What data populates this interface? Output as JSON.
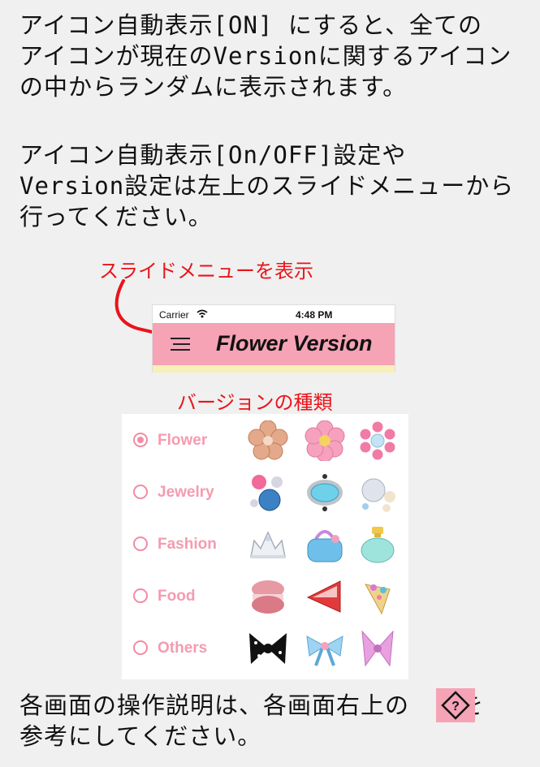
{
  "intro": {
    "lines": [
      "アイコン自動表示[ON] にすると、全ての",
      "アイコンが現在のVersionに関するアイコン",
      "の中からランダムに表示されます。"
    ]
  },
  "settings_note": {
    "lines": [
      "アイコン自動表示[On/OFF]設定や",
      "Version設定は左上のスライドメニューから",
      "行ってください。"
    ]
  },
  "annotations": {
    "menu_label": "スライドメニューを表示",
    "types_label": "バージョンの種類",
    "color": "#e8141b"
  },
  "phone": {
    "carrier": "Carrier",
    "wifi_icon": "wifi-icon",
    "time": "4:48 PM",
    "menu_icon": "hamburger-menu-icon",
    "title": "Flower Version",
    "nav_color": "#f5a3b5"
  },
  "versions": [
    {
      "label": "Flower",
      "selected": true,
      "icons": [
        "copper-flower-icon",
        "pink-flower-icon",
        "jewel-flower-icon"
      ]
    },
    {
      "label": "Jewelry",
      "selected": false,
      "icons": [
        "gems-icon",
        "aquamarine-icon",
        "diamond-pearl-icon"
      ]
    },
    {
      "label": "Fashion",
      "selected": false,
      "icons": [
        "tiara-icon",
        "handbag-icon",
        "perfume-icon"
      ]
    },
    {
      "label": "Food",
      "selected": false,
      "icons": [
        "macaron-icon",
        "strawberry-icon",
        "cake-icon"
      ]
    },
    {
      "label": "Others",
      "selected": false,
      "icons": [
        "black-ribbon-icon",
        "blue-ribbon-icon",
        "pink-bow-icon"
      ]
    }
  ],
  "footer": {
    "line1_before": "各画面の操作説明は、各画面右上の",
    "line1_after": "を",
    "line2": "参考にしてください。",
    "help_icon": "help-diamond-icon"
  }
}
